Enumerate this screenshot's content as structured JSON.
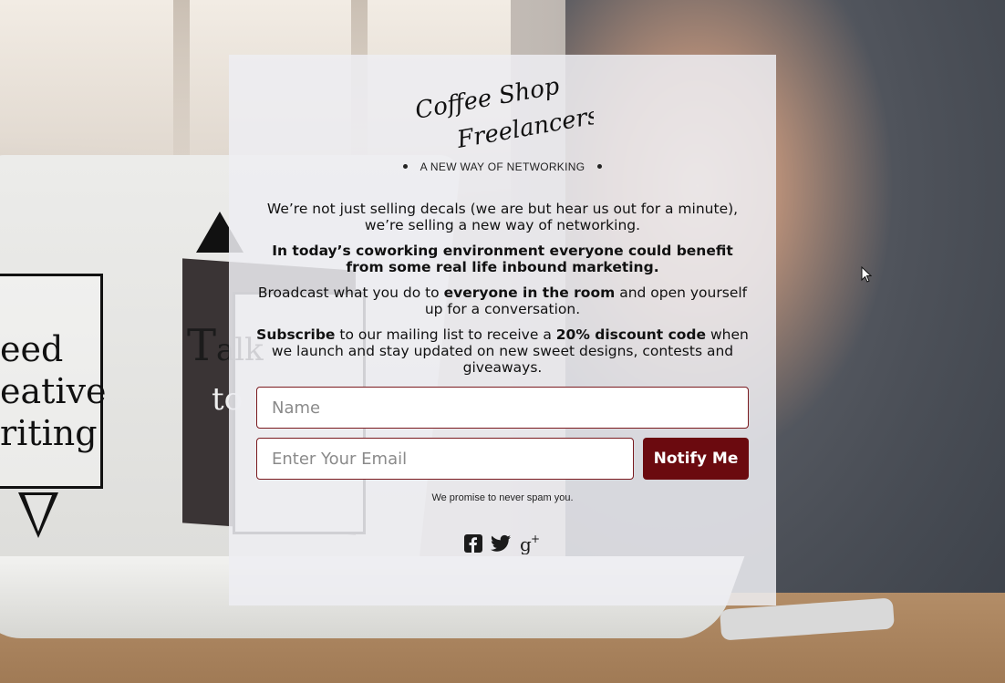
{
  "brand": {
    "logo_line1": "Coffee Shop",
    "logo_line2": "Freelancers",
    "tagline": "A NEW WAY OF NETWORKING"
  },
  "copy": {
    "p1": "We’re not just selling decals (we are but hear us out for a minute), we’re selling a new way of networking.",
    "p2": "In today’s coworking environment everyone could benefit from some real life inbound marketing.",
    "p3_before": "Broadcast what you do to ",
    "p3_bold": "everyone in the room",
    "p3_after": " and open yourself up for a conversation.",
    "p4_bold1": "Subscribe",
    "p4_mid": " to our mailing list to receive a ",
    "p4_bold2": "20% discount code",
    "p4_after": " when we launch and stay updated on new sweet designs, contests and giveaways."
  },
  "form": {
    "name_placeholder": "Name",
    "email_placeholder": "Enter Your Email",
    "submit_label": "Notify Me",
    "promise": "We promise to never spam you."
  },
  "social": {
    "icons": [
      "facebook-icon",
      "twitter-icon",
      "google-plus-icon"
    ]
  },
  "background": {
    "decal_left_text": "eed\neative\nriting",
    "decal_book_letter": "T",
    "decal_book_word": "alk",
    "decal_book_word2": "to y"
  },
  "colors": {
    "accent": "#6b0a0f",
    "field_border": "#7a1a1f",
    "panel_bg": "rgba(237,237,242,0.86)"
  }
}
